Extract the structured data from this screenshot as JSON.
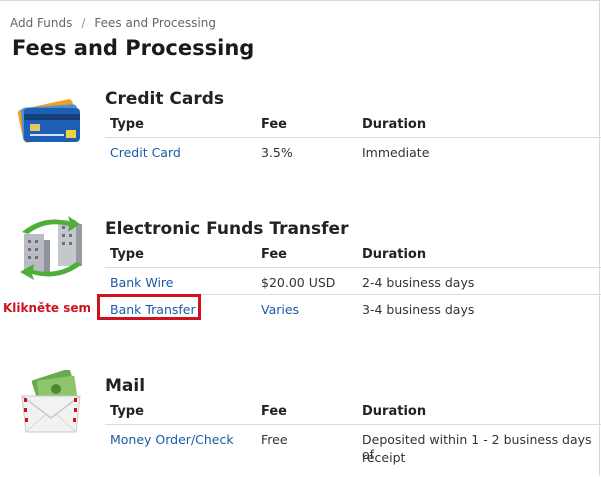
{
  "breadcrumb": {
    "items": [
      "Add Funds",
      "Fees and Processing"
    ],
    "separator": "/"
  },
  "page_title": "Fees and Processing",
  "annotation": {
    "text": "Klikněte sem",
    "color": "#d0121c"
  },
  "colors": {
    "link": "#1a5aa6",
    "highlight": "#d0121c"
  },
  "sections": [
    {
      "title": "Credit Cards",
      "icon": "credit-cards-icon",
      "headers": {
        "type": "Type",
        "fee": "Fee",
        "duration": "Duration"
      },
      "rows": [
        {
          "type": "Credit Card",
          "fee": "3.5%",
          "duration": "Immediate"
        }
      ]
    },
    {
      "title": "Electronic Funds Transfer",
      "icon": "bank-transfer-icon",
      "headers": {
        "type": "Type",
        "fee": "Fee",
        "duration": "Duration"
      },
      "rows": [
        {
          "type": "Bank Wire",
          "fee": "$20.00 USD",
          "duration": "2-4 business days"
        },
        {
          "type": "Bank Transfer",
          "fee": "Varies",
          "duration": "3-4 business days"
        }
      ]
    },
    {
      "title": "Mail",
      "icon": "mail-envelope-icon",
      "headers": {
        "type": "Type",
        "fee": "Fee",
        "duration": "Duration"
      },
      "rows": [
        {
          "type": "Money Order/Check",
          "fee": "Free",
          "duration_line1": "Deposited within 1 - 2 business days of",
          "duration_line2": "receipt"
        }
      ]
    }
  ]
}
